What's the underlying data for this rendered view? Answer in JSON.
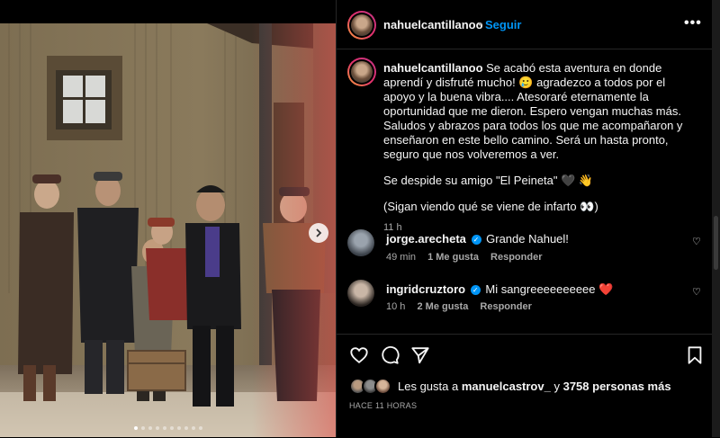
{
  "post": {
    "username": "nahuelcantillanoo",
    "follow_label": "Seguir",
    "separator": "•",
    "more": "•••",
    "caption": {
      "text1": "Se acabó esta aventura en donde aprendí y disfruté mucho! 🥲 agradezco a todos por el apoyo y la buena vibra.... Atesoraré eternamente la oportunidad que me dieron. Espero vengan muchas más. Saludos y abrazos para todos los que me acompañaron y enseñaron en este bello camino. Será un hasta pronto, seguro que nos volveremos a ver.",
      "text2": "Se despide su amigo \"El Peineta\" 🖤 👋",
      "text3": "(Sigan viendo qué se viene de infarto 👀)",
      "time": "11 h"
    }
  },
  "comments": [
    {
      "username": "jorge.arecheta",
      "text": "Grande Nahuel!",
      "time": "49 min",
      "likes": "1 Me gusta",
      "reply": "Responder"
    },
    {
      "username": "ingridcruztoro",
      "text": "Mi sangreeeeeeeeee ❤️",
      "time": "10 h",
      "likes": "2 Me gusta",
      "reply": "Responder"
    }
  ],
  "likes": {
    "prefix": "Les gusta a",
    "user": "manuelcastrov_",
    "joiner": "y",
    "count_text": "3758 personas más"
  },
  "timeago": "HACE 11 HORAS",
  "icons": {
    "heart": "heart-icon",
    "comment": "comment-icon",
    "share": "share-icon",
    "save": "bookmark-icon",
    "next": "chevron-right-icon",
    "verified": "verified-badge-icon",
    "more": "more-options-icon"
  },
  "carousel": {
    "total": 10,
    "current": 1
  },
  "colors": {
    "link": "#0095f6",
    "background": "#000000",
    "muted": "#a8a8a8",
    "heart_red": "#ed4956"
  }
}
